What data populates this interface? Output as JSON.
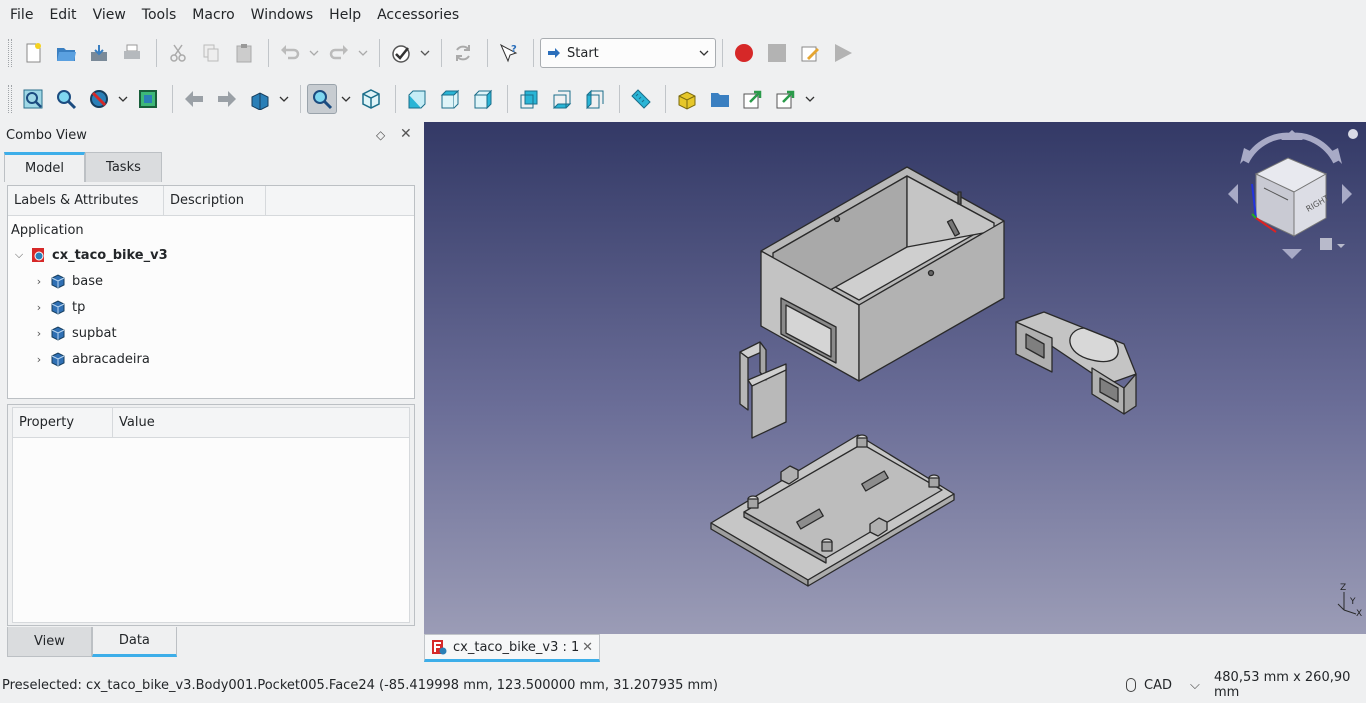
{
  "menu": [
    "File",
    "Edit",
    "View",
    "Tools",
    "Macro",
    "Windows",
    "Help",
    "Accessories"
  ],
  "toolbar": {
    "workbench": "Start"
  },
  "combo": {
    "title": "Combo View",
    "tabs": [
      "Model",
      "Tasks"
    ],
    "tree_columns": [
      "Labels & Attributes",
      "Description"
    ],
    "tree_root": "Application",
    "document": "cx_taco_bike_v3",
    "bodies": [
      "base",
      "tp",
      "supbat",
      "abracadeira"
    ],
    "property_columns": [
      "Property",
      "Value"
    ],
    "bottom_tabs": [
      "View",
      "Data"
    ]
  },
  "document_tab": {
    "label": "cx_taco_bike_v3 : 1"
  },
  "navcube": {
    "face_label": "RIGHT"
  },
  "axis": {
    "x": "X",
    "y": "Y",
    "z": "Z"
  },
  "status": {
    "message": "Preselected: cx_taco_bike_v3.Body001.Pocket005.Face24 (-85.419998 mm, 123.500000 mm, 31.207935 mm)",
    "nav_style": "CAD",
    "dimensions": "480,53 mm x 260,90 mm"
  },
  "colors": {
    "accent": "#3daee9",
    "record": "#d62828",
    "view_top": "#333966",
    "view_bottom": "#9b9cb6",
    "part_fill": "#bdbdbd"
  }
}
